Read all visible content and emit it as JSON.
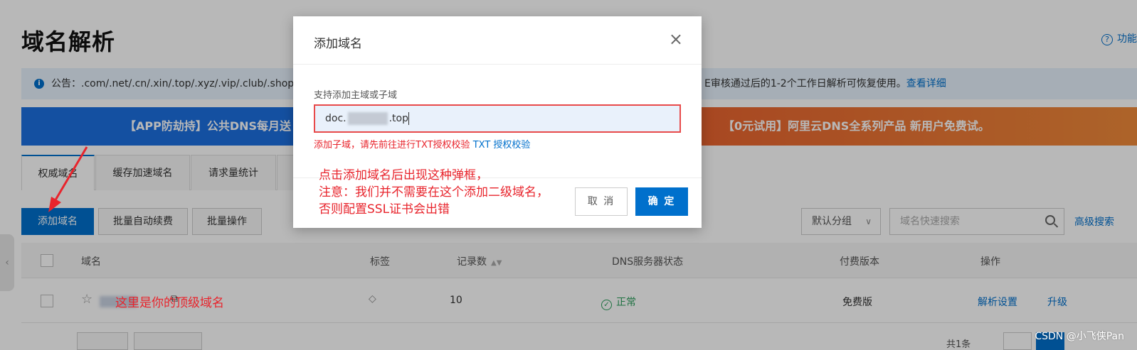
{
  "page": {
    "title": "域名解析",
    "help_label": "功能",
    "notice_prefix": "公告：.com/.net/.cn/.xin/.top/.xyz/.vip/.club/.shop/",
    "notice_suffix": "E审核通过后的1-2个工作日解析可恢复使用。",
    "notice_link": "查看详细",
    "banner_left": "【APP防劫持】公共DNS每月送",
    "banner_right": "【0元试用】阿里云DNS全系列产品 新用户免费试。"
  },
  "tabs": [
    {
      "label": "权威域名"
    },
    {
      "label": "缓存加速域名"
    },
    {
      "label": "请求量统计"
    }
  ],
  "toolbar": {
    "add_domain": "添加域名",
    "batch_renew": "批量自动续费",
    "batch_ops": "批量操作",
    "group_select": "默认分组",
    "search_placeholder": "域名快速搜索",
    "advanced_search": "高级搜索"
  },
  "table": {
    "headers": {
      "domain": "域名",
      "tag": "标签",
      "records": "记录数",
      "dns_status": "DNS服务器状态",
      "plan": "付费版本",
      "actions": "操作"
    },
    "rows": [
      {
        "records": "10",
        "dns_status": "正常",
        "plan": "免费版",
        "action_settings": "解析设置",
        "action_upgrade": "升级"
      }
    ],
    "footer_partial": "共1条"
  },
  "annotations": {
    "top_domain_note": "这里是你的顶级域名",
    "modal_note_lines": [
      "点击添加域名后出现这种弹框，",
      "注意：我们并不需要在这个添加二级域名，",
      "否则配置SSL证书会出错"
    ]
  },
  "modal": {
    "title": "添加域名",
    "close_symbol": "×",
    "field_label": "支持添加主域或子域",
    "input_prefix": "doc.",
    "input_suffix": ".top",
    "tip_text": "添加子域，请先前往进行TXT授权校验",
    "tip_link": "TXT 授权校验",
    "cancel": "取 消",
    "confirm": "确 定"
  },
  "watermark": "CSDN @小飞侠Pan",
  "colors": {
    "primary": "#0070cc",
    "annotation_red": "#e8242c",
    "status_green": "#2a9d5b",
    "banner_blue": "#1d6fe0",
    "banner_orange": "#e9632f"
  }
}
